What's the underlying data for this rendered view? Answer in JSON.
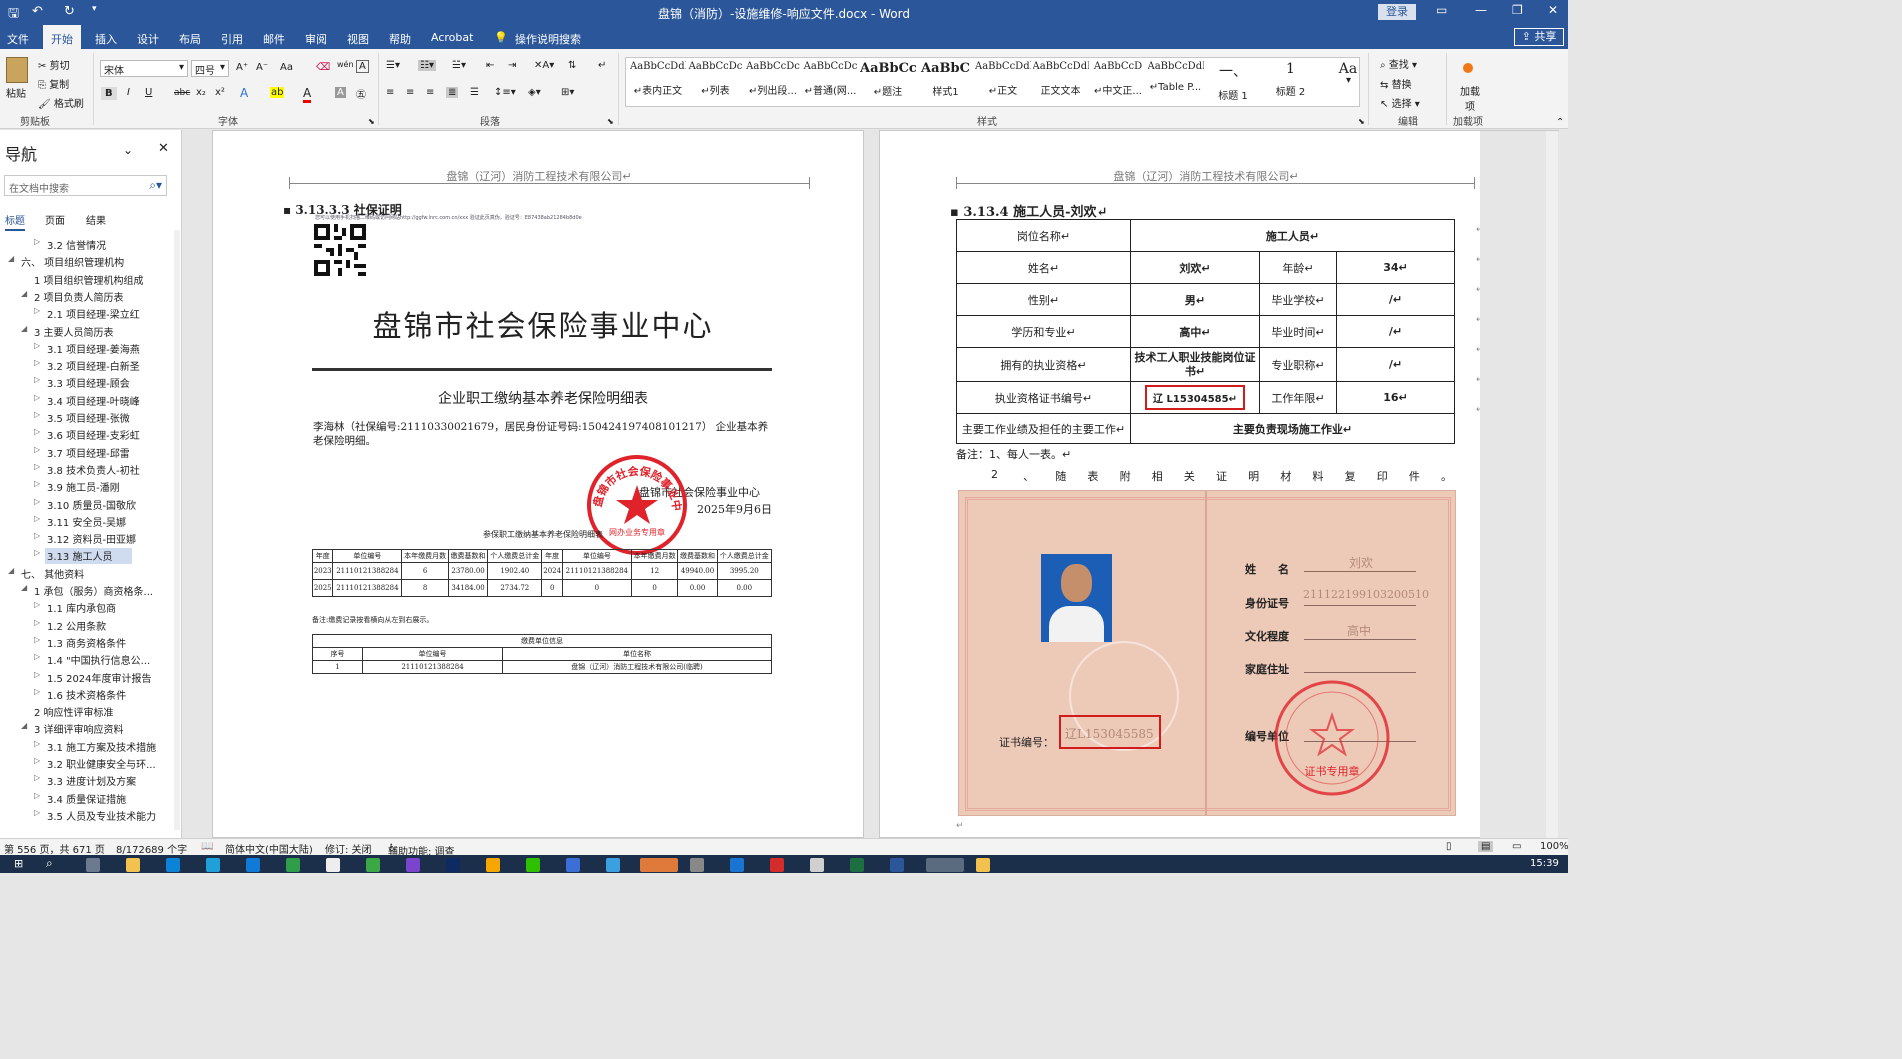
{
  "window": {
    "title": "盘锦（消防）-设施维修-响应文件.docx  -  Word",
    "login": "登录",
    "minimize": "—",
    "restore": "❐",
    "close": "✕",
    "ribbon_display": "▭"
  },
  "tabs": [
    "文件",
    "开始",
    "插入",
    "设计",
    "布局",
    "引用",
    "邮件",
    "审阅",
    "视图",
    "帮助",
    "Acrobat",
    "操作说明搜索"
  ],
  "share": "共享",
  "ribbon": {
    "clipboard": {
      "paste": "粘贴",
      "cut": "剪切",
      "copy": "复制",
      "format_painter": "格式刷",
      "label": "剪贴板"
    },
    "font": {
      "name": "宋体",
      "size": "四号",
      "label": "字体",
      "bold": "B",
      "italic": "I",
      "underline": "U",
      "strike": "abc",
      "sub": "x₂",
      "sup": "x²",
      "case": "Aa",
      "grow": "A⁺",
      "shrink": "A⁻",
      "color": "A",
      "highlight": "ab"
    },
    "paragraph": {
      "label": "段落"
    },
    "styles": {
      "label": "样式",
      "items": [
        {
          "preview": "AaBbCcDdI",
          "name": "↵表内正文"
        },
        {
          "preview": "AaBbCcDc",
          "name": "↵列表"
        },
        {
          "preview": "AaBbCcDc",
          "name": "↵列出段..."
        },
        {
          "preview": "AaBbCcDc",
          "name": "↵普通(网..."
        },
        {
          "preview": "AaBbCc",
          "name": "↵题注"
        },
        {
          "preview": "AaBbC",
          "name": "样式1"
        },
        {
          "preview": "AaBbCcDdI",
          "name": "↵正文"
        },
        {
          "preview": "AaBbCcDdI",
          "name": "正文文本"
        },
        {
          "preview": "AaBbCcD",
          "name": "↵中文正..."
        },
        {
          "preview": "AaBbCcDdI",
          "name": "↵Table P..."
        },
        {
          "preview": "一、",
          "name": "标题 1"
        },
        {
          "preview": "1",
          "name": "标题 2"
        },
        {
          "preview": "Aa",
          "name": ""
        }
      ]
    },
    "editing": {
      "find": "查找",
      "replace": "替换",
      "select": "选择",
      "label": "编辑"
    },
    "addin": {
      "load": "加载项",
      "label": "加载项"
    }
  },
  "nav": {
    "title": "导航",
    "search_placeholder": "在文档中搜索",
    "tabs": [
      "标题",
      "页面",
      "结果"
    ],
    "items": [
      "3.2 信誉情况",
      "六、 项目组织管理机构",
      "1 项目组织管理机构组成",
      "2 项目负责人简历表",
      "2.1 项目经理-梁立红",
      "3 主要人员简历表",
      "3.1 项目经理-姜海燕",
      "3.2 项目经理-白新圣",
      "3.3 项目经理-顾会",
      "3.4 项目经理-叶晓峰",
      "3.5 项目经理-张微",
      "3.6 项目经理-支彩虹",
      "3.7 项目经理-邱雷",
      "3.8 技术负责人-初社",
      "3.9 施工员-潘刚",
      "3.10 质量员-国敬欣",
      "3.11 安全员-吴娜",
      "3.12 资料员-田亚娜",
      "3.13 施工人员",
      "七、 其他资料",
      "1 承包（服务）商资格条...",
      "1.1 库内承包商",
      "1.2 公用条款",
      "1.3 商务资格条件",
      "1.4 \"中国执行信息公...",
      "1.5 2024年度审计报告",
      "1.6 技术资格条件",
      "2 响应性评审标准",
      "3 详细评审响应资料",
      "3.1 施工方案及技术措施",
      "3.2 职业健康安全与环...",
      "3.3 进度计划及方案",
      "3.4 质量保证措施",
      "3.5 人员及专业技术能力"
    ]
  },
  "left_page": {
    "header": "盘锦（辽河）消防工程技术有限公司↵",
    "heading": "3.13.3.3 社保证明",
    "url_line": "您可以使用手机扫描二维码或访问网站http://ggfw.lnrc.com.cn/xxx 验证此页真伪，验证号：E87438ab21284b8d0e",
    "center_title": "盘锦市社会保险事业中心",
    "subtitle": "企业职工缴纳基本养老保险明细表",
    "person": "李海林（社保编号:21110330021679，居民身份证号码:150424197408101217） 企业基本养老保险明细。",
    "issuer": "盘锦市社会保险事业中心",
    "date": "2025年9月6日",
    "seal_text": "盘锦市社会保险事业中心",
    "seal_sub": "网办业务专用章",
    "table_title": "参保职工缴纳基本养老保险明细表",
    "table_headers": [
      "年度",
      "单位编号",
      "本年缴费月数",
      "缴费基数和",
      "个人缴费总计金",
      "年度",
      "单位编号",
      "本年缴费月数",
      "缴费基数和",
      "个人缴费总计金"
    ],
    "table_rows": [
      [
        "2023",
        "211101213882​84",
        "6",
        "23780.00",
        "1902.40",
        "2024",
        "211101213882​84",
        "12",
        "49940.00",
        "3995.20"
      ],
      [
        "2025",
        "211101213882​84",
        "8",
        "34184.00",
        "2734.72",
        "0",
        "0",
        "0",
        "0.00",
        "0.00"
      ]
    ],
    "note": "备注:缴费记录按看横向从左到右展示。",
    "unit_title": "缴费单位信息",
    "unit_headers": [
      "序号",
      "单位编号",
      "单位名称"
    ],
    "unit_row": [
      "1",
      "211101213882​84",
      "盘锦（辽河）消防工程技术有限公司(临聘)"
    ]
  },
  "right_page": {
    "header": "盘锦（辽河）消防工程技术有限公司↵",
    "heading": "3.13.4 施工人员-刘欢↵",
    "rows": [
      {
        "k1": "岗位名称↵",
        "v1": "施工人员↵"
      },
      {
        "k1": "姓名↵",
        "v1": "刘欢↵",
        "k2": "年龄↵",
        "v2": "34↵"
      },
      {
        "k1": "性别↵",
        "v1": "男↵",
        "k2": "毕业学校↵",
        "v2": "/↵"
      },
      {
        "k1": "学历和专业↵",
        "v1": "高中↵",
        "k2": "毕业时间↵",
        "v2": "/↵"
      },
      {
        "k1": "拥有的执业资格↵",
        "v1": "技术工人职业技能岗位证书↵",
        "k2": "专业职称↵",
        "v2": "/↵"
      },
      {
        "k1": "执业资格证书编号↵",
        "v1": "辽 L15304585↵",
        "k2": "工作年限↵",
        "v2": "16↵"
      },
      {
        "k1": "主要工作业绩及担任的主要工作↵",
        "v1": "主要负责现场施工作业↵"
      }
    ],
    "note1": "备注：1、每人一表。↵",
    "note2": [
      "2",
      "、",
      "随",
      "表",
      "附",
      "相",
      "关",
      "证",
      "明",
      "材",
      "料",
      "复",
      "印",
      "件",
      "。"
    ],
    "cert": {
      "name_label": "姓　　名",
      "name_value": "刘欢",
      "id_label": "身份证号",
      "id_value": "211122199103200510",
      "edu_label": "文化程度",
      "edu_value": "高中",
      "addr_label": "家庭住址",
      "no_label": "证书编号：",
      "no_value": "辽L153045585",
      "unit_label": "编号单位",
      "stamp": "证书专用章"
    }
  },
  "status": {
    "page": "第 556 页，共 671 页",
    "words": "8/172689 个字",
    "lang": "简体中文(中国大陆)",
    "track": "修订: 关闭",
    "access": "辅助功能: 调查",
    "zoom": "100%"
  },
  "taskbar": {
    "time": "15:39"
  },
  "colors": {
    "brand": "#2b579a",
    "red_box": "#d01c1c",
    "seal": "#e0232b"
  }
}
